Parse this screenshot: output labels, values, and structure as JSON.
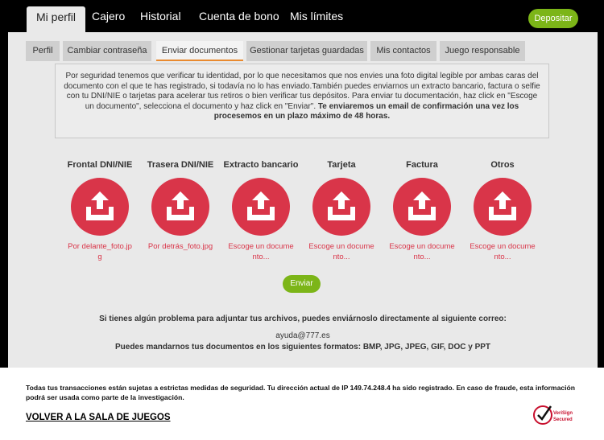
{
  "nav": {
    "tabs": [
      {
        "label": "Mi perfil",
        "active": true
      },
      {
        "label": "Cajero"
      },
      {
        "label": "Historial"
      },
      {
        "label": "Cuenta de bono"
      },
      {
        "label": "Mis límites"
      }
    ],
    "deposit_label": "Depositar"
  },
  "subtabs": [
    {
      "label": "Perfil"
    },
    {
      "label": "Cambiar contraseña"
    },
    {
      "label": "Enviar documentos",
      "active": true
    },
    {
      "label": "Gestionar tarjetas guardadas"
    },
    {
      "label": "Mis contactos"
    },
    {
      "label": "Juego responsable"
    }
  ],
  "info": {
    "text": "Por seguridad tenemos que verificar tu identidad, por lo que necesitamos que nos envies una foto digital legible por ambas caras del documento con el que te has registrado, si todavía no lo has enviado.También puedes enviarnos un extracto bancario, factura o selfie con tu DNI/NIE o tarjetas para acelerar tus retiros o bien verificar tus depósitos. Para enviar tu documentación, haz click en \"Escoge un documento\", selecciona el documento y haz click en \"Enviar\".",
    "bold": "Te enviaremos un email de confirmación una vez los procesemos en un plazo máximo de 48 horas."
  },
  "documents": [
    {
      "title": "Frontal DNI/NIE",
      "file": "Por delante_foto.jpg"
    },
    {
      "title": "Trasera DNI/NIE",
      "file": "Por detrás_foto.jpg"
    },
    {
      "title": "Extracto bancario",
      "file": "Escoge un documento..."
    },
    {
      "title": "Tarjeta",
      "file": "Escoge un documento..."
    },
    {
      "title": "Factura",
      "file": "Escoge un documento..."
    },
    {
      "title": "Otros",
      "file": "Escoge un documento..."
    }
  ],
  "send_label": "Enviar",
  "contact": {
    "problem": "Si tienes algún problema para adjuntar tus archivos, puedes enviárnoslo directamente al siguiente correo:",
    "email": "ayuda@777.es",
    "formats": "Puedes mandarnos tus documentos en los siguientes formatos: BMP, JPG, JPEG, GIF, DOC y PPT"
  },
  "footer": {
    "security": "Todas tus transacciones están sujetas a estrictas medidas de seguridad. Tu dirección actual de IP 149.74.248.4 ha sido registrado. En caso de fraude, esta información podrá ser usada como parte de la investigación.",
    "back": "VOLVER A LA SALA DE JUEGOS",
    "badge_line1": "VeriSign",
    "badge_line2": "Secured"
  },
  "colors": {
    "accent": "#d93549",
    "green": "#7cb518",
    "tab_underline": "#e98a2f"
  }
}
